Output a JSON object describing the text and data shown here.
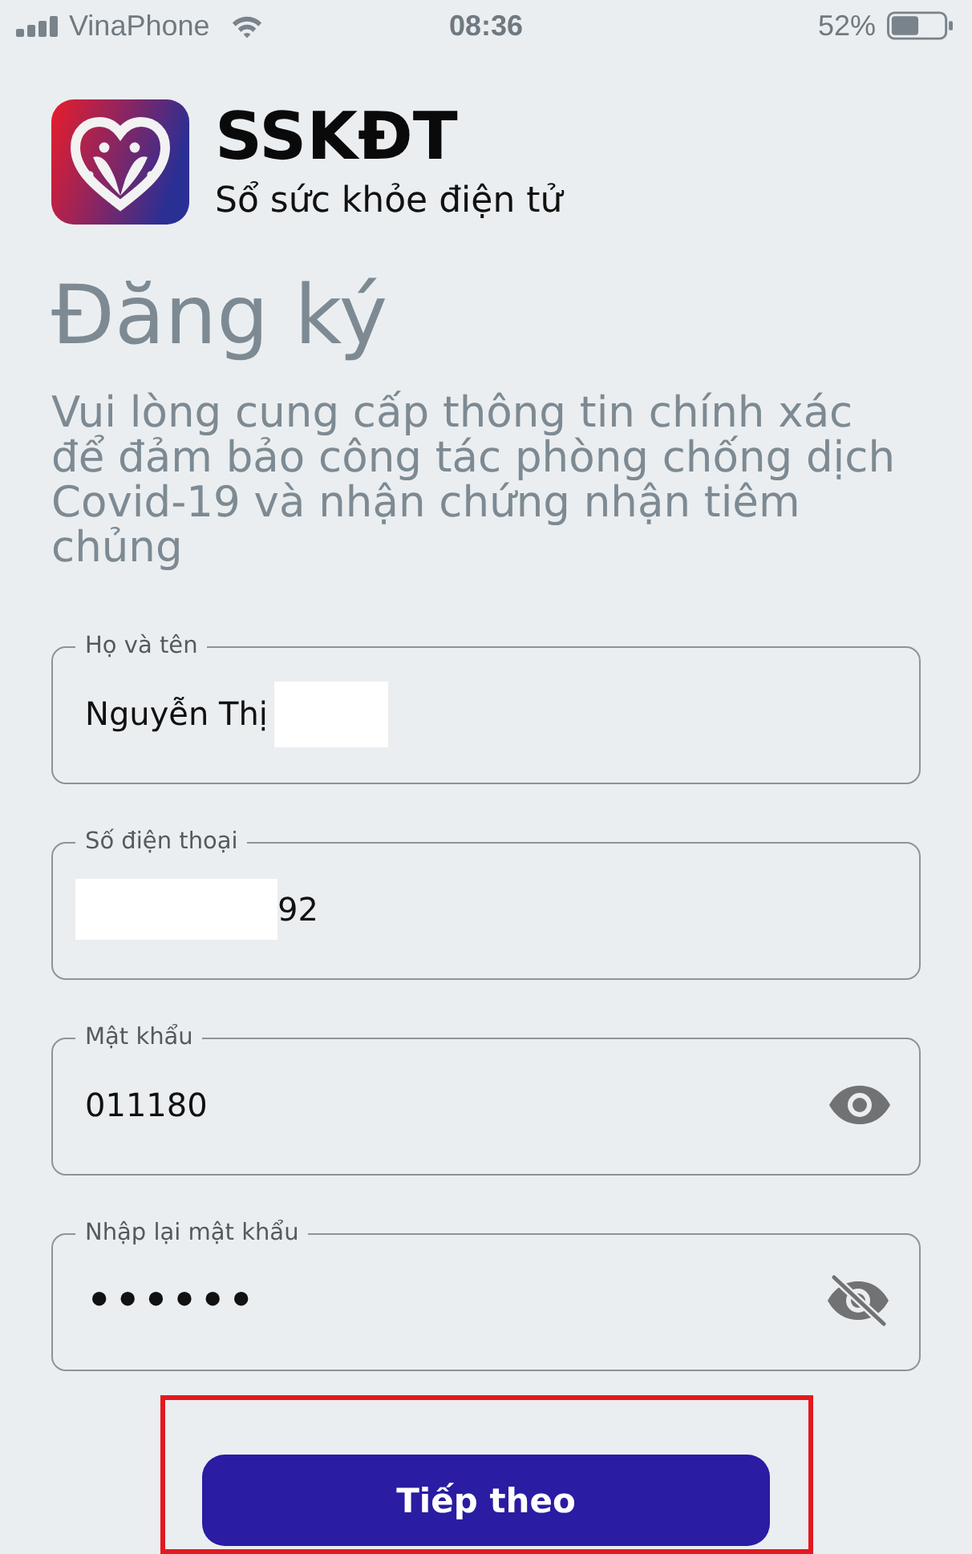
{
  "status_bar": {
    "carrier": "VinaPhone",
    "time": "08:36",
    "battery": "52%"
  },
  "app": {
    "name": "SSKĐT",
    "subtitle": "Sổ sức khỏe điện tử"
  },
  "heading": "Đăng ký",
  "intro": "Vui lòng cung cấp thông tin chính xác để đảm bảo công tác phòng chống dịch Covid-19 và nhận chứng nhận tiêm chủng",
  "fields": [
    {
      "kind": "text",
      "label": "Họ và tên",
      "value": "Nguyễn Thị",
      "redacted_after": true
    },
    {
      "kind": "text",
      "label": "Số điện thoại",
      "value": "92",
      "redacted_before": true
    },
    {
      "kind": "password",
      "label": "Mật khẩu",
      "value": "011180",
      "visible": true
    },
    {
      "kind": "password",
      "label": "Nhập lại mật khẩu",
      "value": "••••••",
      "visible": false
    }
  ],
  "submit": {
    "label": "Tiếp theo",
    "highlighted": true
  }
}
